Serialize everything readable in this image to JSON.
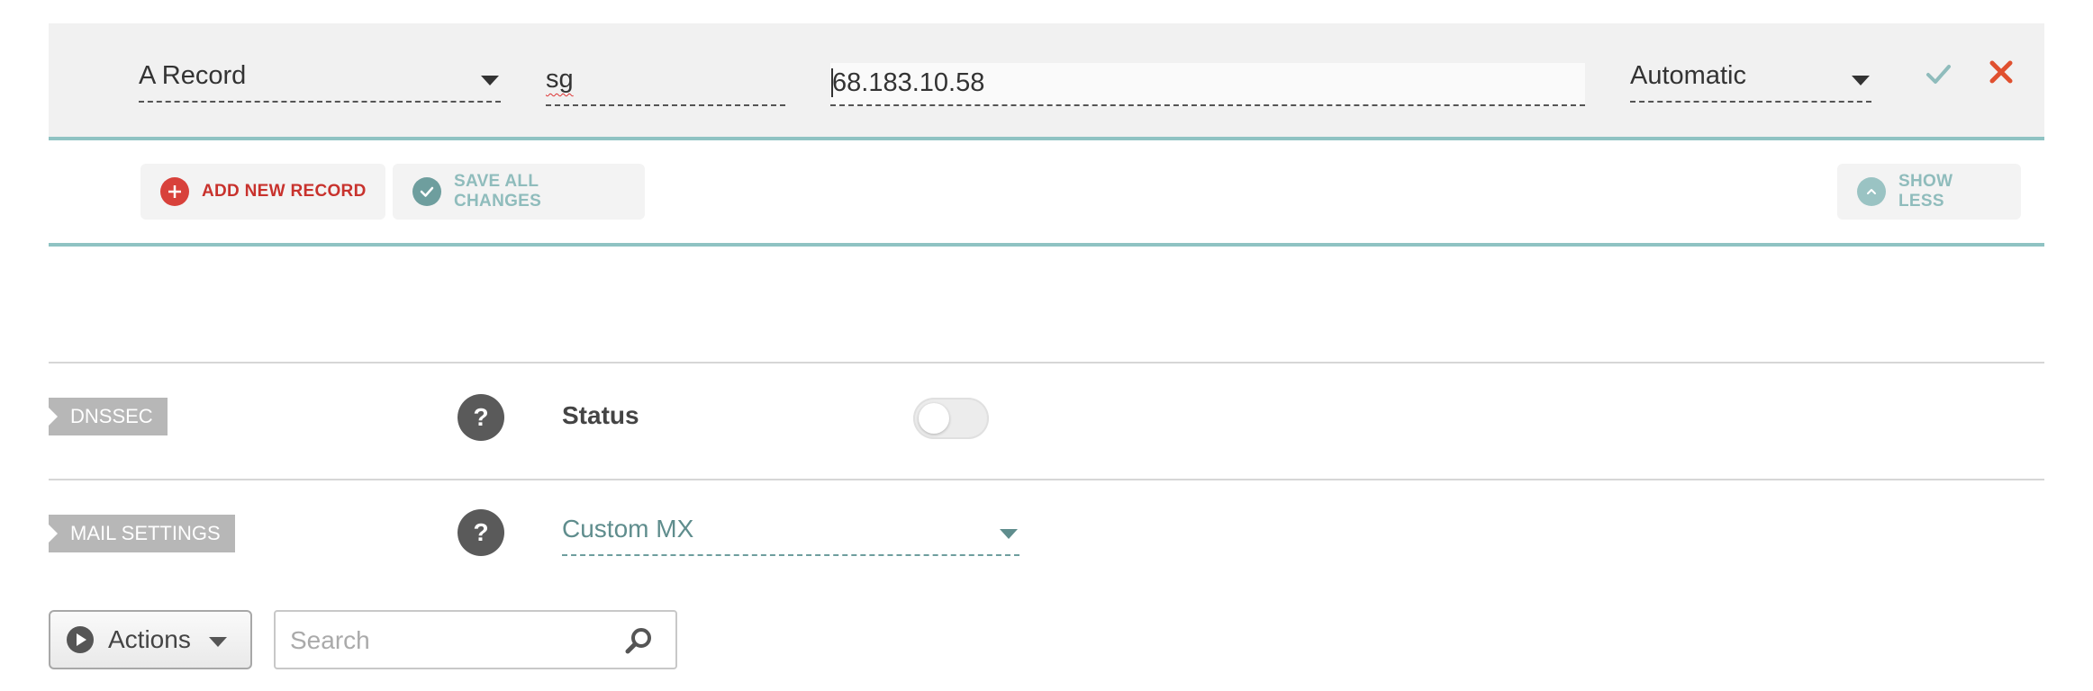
{
  "record_editor": {
    "type_select": {
      "value": "A Record"
    },
    "host_input": {
      "value": "sg"
    },
    "value_input": {
      "value": "68.183.10.58"
    },
    "ttl_select": {
      "value": "Automatic"
    },
    "icons": {
      "confirm": "check-icon",
      "cancel": "close-icon"
    },
    "colors": {
      "confirm": "#8fbcbc",
      "cancel": "#e0502f"
    }
  },
  "action_bar": {
    "add_label": "ADD NEW RECORD",
    "save_label": "SAVE ALL CHANGES",
    "show_less_label": "SHOW LESS",
    "colors": {
      "add": "#c8322d",
      "save": "#8fbcbc",
      "accent_line": "#8fc3c3"
    }
  },
  "dnssec": {
    "tag": "DNSSEC",
    "help": "?",
    "status_label": "Status",
    "status_enabled": false
  },
  "mail_settings": {
    "tag": "MAIL SETTINGS",
    "help": "?",
    "select_value": "Custom MX"
  },
  "toolbar": {
    "actions_label": "Actions",
    "search_placeholder": "Search",
    "search_value": ""
  }
}
